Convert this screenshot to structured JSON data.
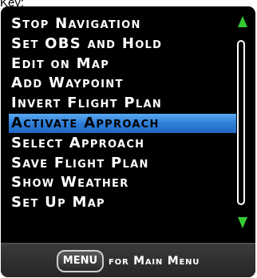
{
  "caption": "Key:",
  "menu": {
    "items": [
      {
        "label": "Stop Navigation"
      },
      {
        "label": "Set OBS and Hold"
      },
      {
        "label": "Edit on Map"
      },
      {
        "label": "Add Waypoint"
      },
      {
        "label": "Invert Flight Plan"
      },
      {
        "label": "Activate Approach"
      },
      {
        "label": "Select Approach"
      },
      {
        "label": "Save Flight Plan"
      },
      {
        "label": "Show Weather"
      },
      {
        "label": "Set Up Map"
      }
    ],
    "selected_index": 5,
    "highlight_color": "#2f7fd8",
    "scroll_arrow_color": "#33cc33"
  },
  "footer": {
    "key_label": "MENU",
    "text": "for Main Menu"
  }
}
